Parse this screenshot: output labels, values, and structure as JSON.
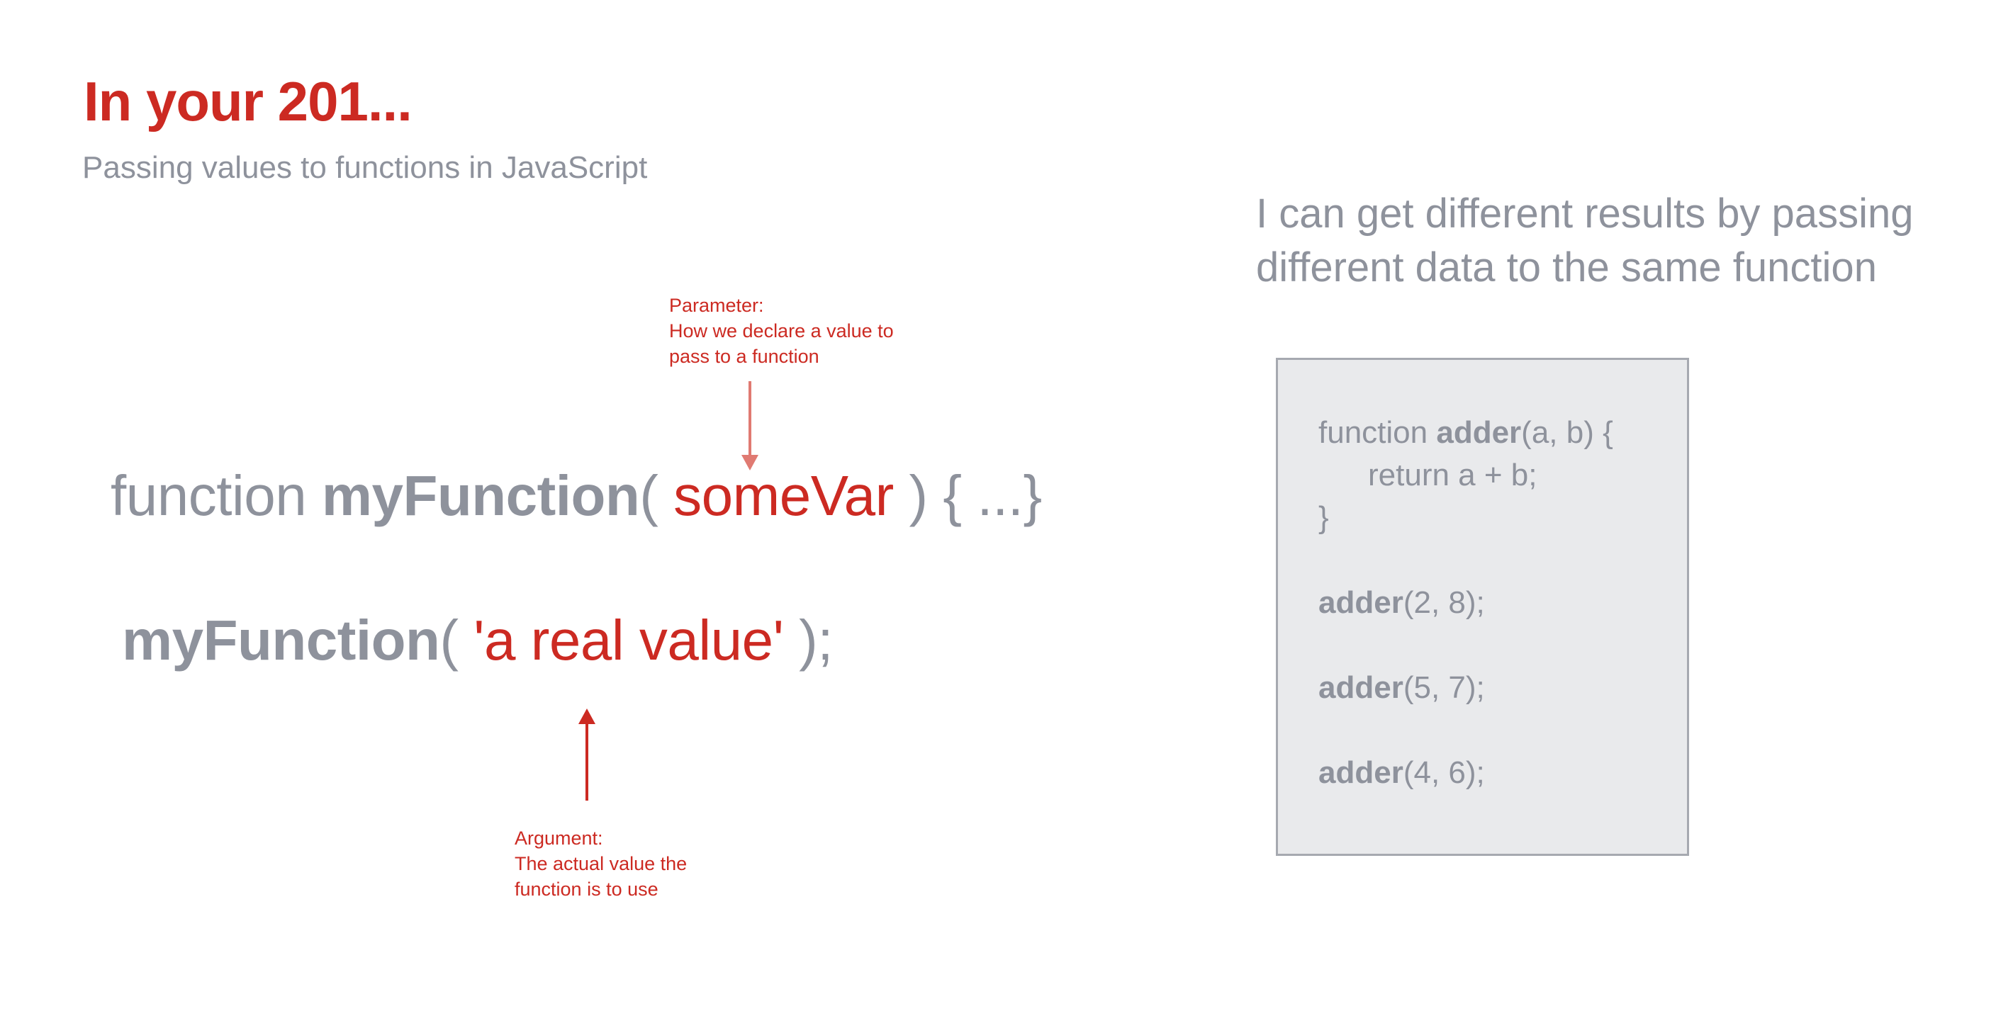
{
  "slide": {
    "title": "In your 201...",
    "subtitle": "Passing values to functions in JavaScript"
  },
  "annotations": {
    "parameter": {
      "heading": "Parameter:",
      "line1": "How we declare a value to",
      "line2": "pass to a function"
    },
    "argument": {
      "heading": "Argument:",
      "line1": "The actual value the",
      "line2": "function is to use"
    }
  },
  "declaration": {
    "keyword": "function ",
    "name": "myFunction",
    "open": "( ",
    "param": "someVar",
    "rest": " ) { ...}"
  },
  "call": {
    "name": "myFunction",
    "open": "( ",
    "arg": "'a real value'",
    "rest": " );"
  },
  "right_heading": "I can get different results by passing different data to the same function",
  "code_box": {
    "l1_kw": "function ",
    "l1_name": "adder",
    "l1_rest": "(a, b) {",
    "l2": "return a + b;",
    "l3": "}",
    "calls": [
      {
        "name": "adder",
        "args": "(2, 8);"
      },
      {
        "name": "adder",
        "args": "(5, 7);"
      },
      {
        "name": "adder",
        "args": "(4, 6);"
      }
    ]
  },
  "colors": {
    "accent": "#cc2a22",
    "text_gray": "#8e929c",
    "arrow_light": "#e07a72",
    "box_bg": "#e9eaec",
    "box_border": "#a6a9b0"
  }
}
